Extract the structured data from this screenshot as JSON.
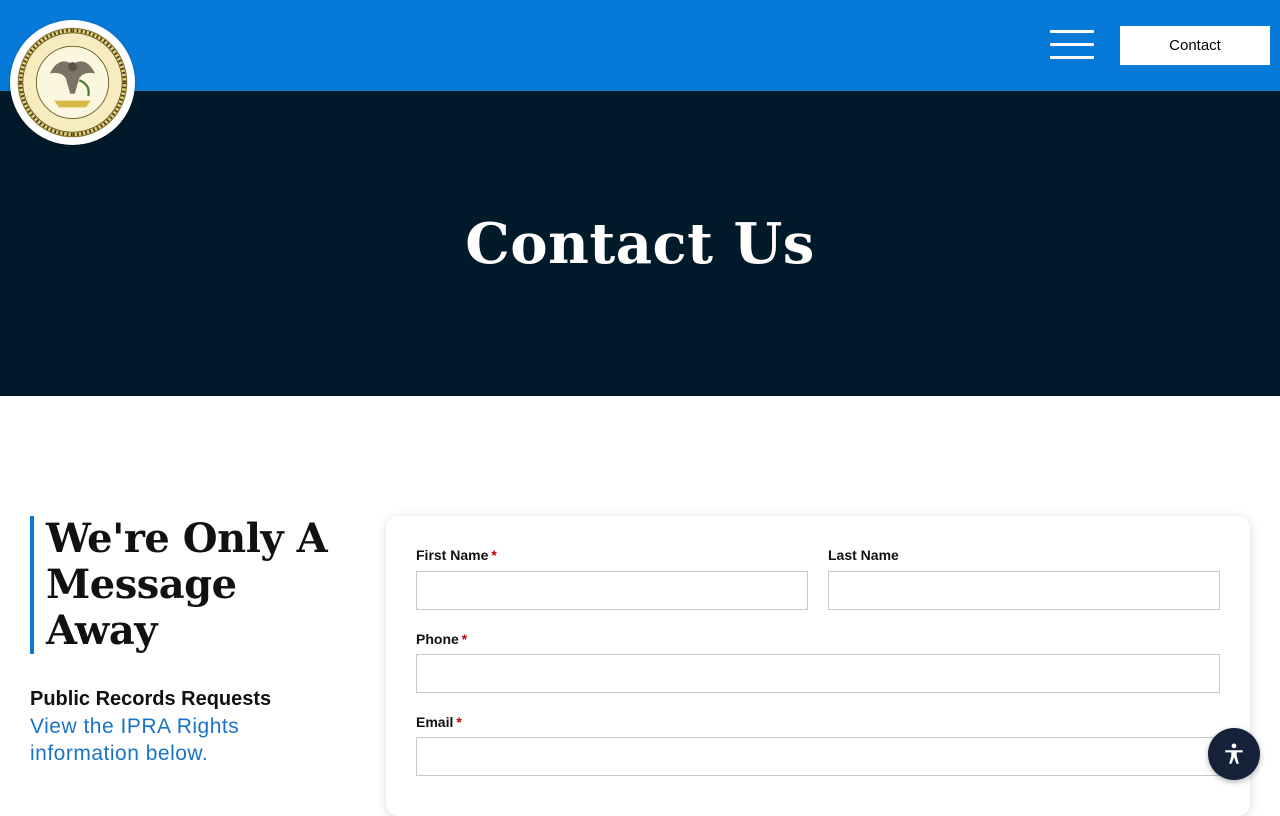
{
  "header": {
    "logo_icon": "state-seal-icon",
    "menu_icon": "hamburger-menu-icon",
    "contact_label": "Contact",
    "brand_color": "#0779d9"
  },
  "hero": {
    "title": "Contact Us",
    "background_color": "#001a29"
  },
  "sidebar": {
    "heading": "We're Only A Message Away",
    "records_title": "Public Records Requests",
    "records_link": "View the IPRA Rights information below."
  },
  "form": {
    "first_name_label": "First Name",
    "last_name_label": "Last Name",
    "phone_label": "Phone",
    "email_label": "Email",
    "required_marker": "*",
    "first_name_value": "",
    "last_name_value": "",
    "phone_value": "",
    "email_value": ""
  },
  "accessibility": {
    "icon": "accessibility-icon"
  }
}
